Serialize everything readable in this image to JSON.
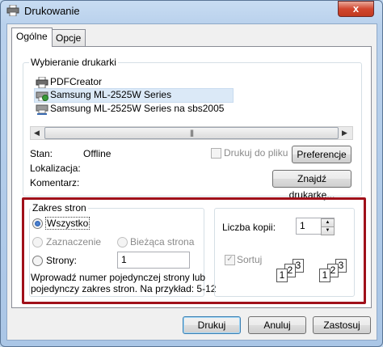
{
  "window": {
    "title": "Drukowanie",
    "close_glyph": "x"
  },
  "tabs": [
    {
      "label": "Ogólne"
    },
    {
      "label": "Opcje"
    }
  ],
  "printer_group": {
    "label": "Wybieranie drukarki",
    "printers": [
      {
        "name": "PDFCreator",
        "icon": "printer-icon"
      },
      {
        "name": "Samsung ML-2525W Series",
        "icon": "printer-default-icon"
      },
      {
        "name": "Samsung ML-2525W Series na sbs2005",
        "icon": "network-printer-icon"
      }
    ],
    "scroll_thumb_glyph": "|||",
    "status_label": "Stan:",
    "status_value": "Offline",
    "location_label": "Lokalizacja:",
    "comment_label": "Komentarz:",
    "print_to_file_label": "Drukuj do pliku",
    "preferences_button": "Preferencje",
    "find_printer_button": "Znajdź drukarkę..."
  },
  "page_range": {
    "label": "Zakres stron",
    "all_label": "Wszystko",
    "selection_label": "Zaznaczenie",
    "current_page_label": "Bieżąca strona",
    "pages_label": "Strony:",
    "pages_value": "1",
    "hint_line1": "Wprowadź numer pojedynczej strony lub",
    "hint_line2": "pojedynczy zakres stron. Na przykład: 5-12"
  },
  "copies": {
    "label": "Liczba kopii:",
    "value": "1",
    "collate_label": "Sortuj",
    "pages": [
      "1",
      "2",
      "3"
    ]
  },
  "footer": {
    "print_button": "Drukuj",
    "cancel_button": "Anuluj",
    "apply_button": "Zastosuj"
  },
  "colors": {
    "highlight": "#a0101a",
    "selection": "#dbe9f7"
  }
}
